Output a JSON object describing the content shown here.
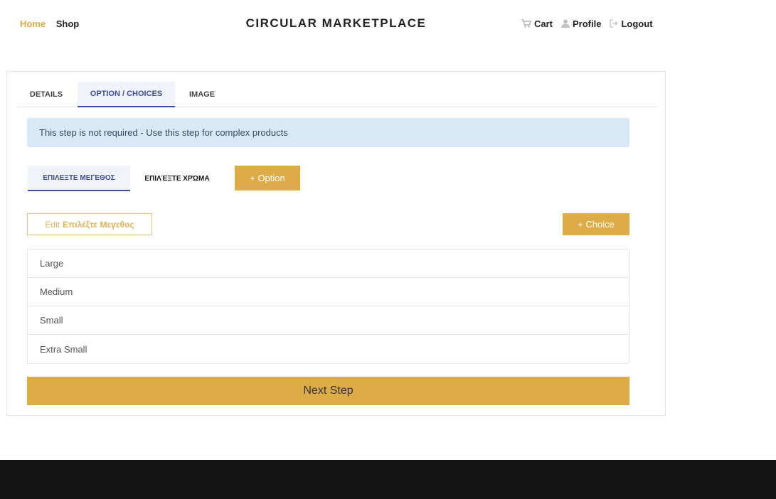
{
  "nav": {
    "home": "Home",
    "shop": "Shop",
    "brand": "CIRCULAR MARKETPLACE",
    "cart": "Cart",
    "profile": "Profile",
    "logout": "Logout"
  },
  "tabs": [
    {
      "label": "DETAILS",
      "active": false
    },
    {
      "label": "OPTION / CHOICES",
      "active": true
    },
    {
      "label": "IMAGE",
      "active": false
    }
  ],
  "alert": "This step is not required - Use this step for complex products",
  "option_tabs": [
    {
      "label": "ΕΠΙΛΕΞΤΕ ΜΕΓΕΘΟΣ",
      "active": true
    },
    {
      "label": "ΕΠΙΛΈΞΤΕ ΧΡΏΜΑ",
      "active": false
    }
  ],
  "add_option": "+ Option",
  "edit_button": {
    "prefix": "Edit",
    "name": "Επιλέξτε Μεγεθος"
  },
  "add_choice": "+ Choice",
  "choices": [
    "Large",
    "Medium",
    "Small",
    "Extra Small"
  ],
  "next_step": "Next Step",
  "colors": {
    "accent": "#deac46",
    "active_tab": "#3c4e9c",
    "alert_bg": "#d9e8f6",
    "footer": "#141313"
  }
}
